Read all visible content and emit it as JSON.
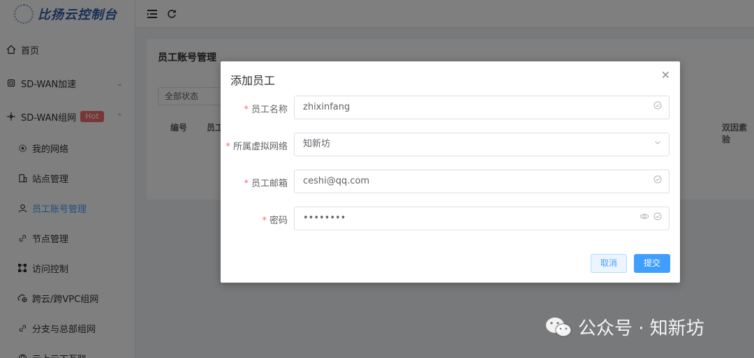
{
  "app": {
    "title": "比扬云控制台"
  },
  "sidebar": {
    "items": [
      {
        "label": "首页",
        "icon": "home-icon"
      },
      {
        "label": "SD-WAN加速",
        "icon": "chip-icon",
        "expand": "down"
      },
      {
        "label": "SD-WAN组网",
        "icon": "network-icon",
        "badge": "Hot",
        "expand": "up"
      },
      {
        "label": "我的网络",
        "icon": "gear-icon"
      },
      {
        "label": "站点管理",
        "icon": "building-icon"
      },
      {
        "label": "员工账号管理",
        "icon": "user-icon",
        "active": true
      },
      {
        "label": "节点管理",
        "icon": "link-icon"
      },
      {
        "label": "访问控制",
        "icon": "nodes-icon"
      },
      {
        "label": "跨云/跨VPC组网",
        "icon": "cloud-globe-icon"
      },
      {
        "label": "分支与总部组网",
        "icon": "link-icon"
      },
      {
        "label": "云上云下互联",
        "icon": "globe-icon"
      }
    ]
  },
  "page": {
    "title": "员工账号管理",
    "status_filter": "全部状态",
    "columns": [
      "编号",
      "员工",
      "双因素验"
    ]
  },
  "dialog": {
    "title": "添加员工",
    "fields": [
      {
        "label": "员工名称",
        "value": "zhixinfang",
        "required": true
      },
      {
        "label": "所属虚拟网络",
        "value": "知新坊",
        "required": true
      },
      {
        "label": "员工邮箱",
        "value": "ceshi@qq.com",
        "required": true
      },
      {
        "label": "密码",
        "value": "••••••••",
        "required": true
      }
    ],
    "cancel_label": "取消",
    "submit_label": "提交"
  },
  "watermark": {
    "text": "公众号 · 知新坊"
  },
  "colors": {
    "primary": "#409eff",
    "danger": "#f56c6c",
    "logo": "#2c5fa8"
  }
}
